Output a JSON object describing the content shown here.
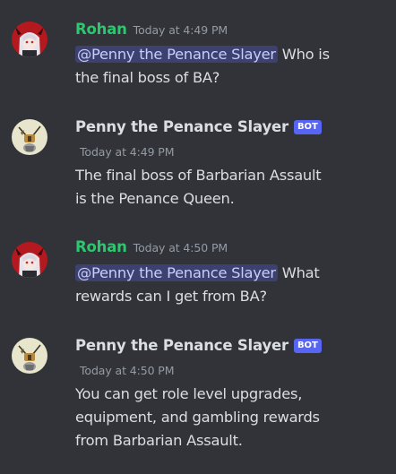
{
  "colors": {
    "background": "#313338",
    "username_green": "#2dc770",
    "bot_badge": "#5865f2",
    "mention_bg": "#3c4270"
  },
  "messages": [
    {
      "author": "Rohan",
      "timestamp": "Today at 4:49 PM",
      "mention": "@Penny the Penance Slayer",
      "line1_rest": " Who is",
      "line2": "the final boss of BA?"
    },
    {
      "author": "Penny the Penance Slayer",
      "badge": "BOT",
      "timestamp": "Today at 4:49 PM",
      "line1": "The final boss of Barbarian Assault",
      "line2": "is the Penance Queen."
    },
    {
      "author": "Rohan",
      "timestamp": "Today at 4:50 PM",
      "mention": "@Penny the Penance Slayer",
      "line1_rest": " What",
      "line2": "rewards can I get from BA?"
    },
    {
      "author": "Penny the Penance Slayer",
      "badge": "BOT",
      "timestamp": "Today at 4:50 PM",
      "line1": "You can get role level upgrades,",
      "line2": "equipment, and gambling rewards",
      "line3": "from Barbarian Assault."
    }
  ]
}
